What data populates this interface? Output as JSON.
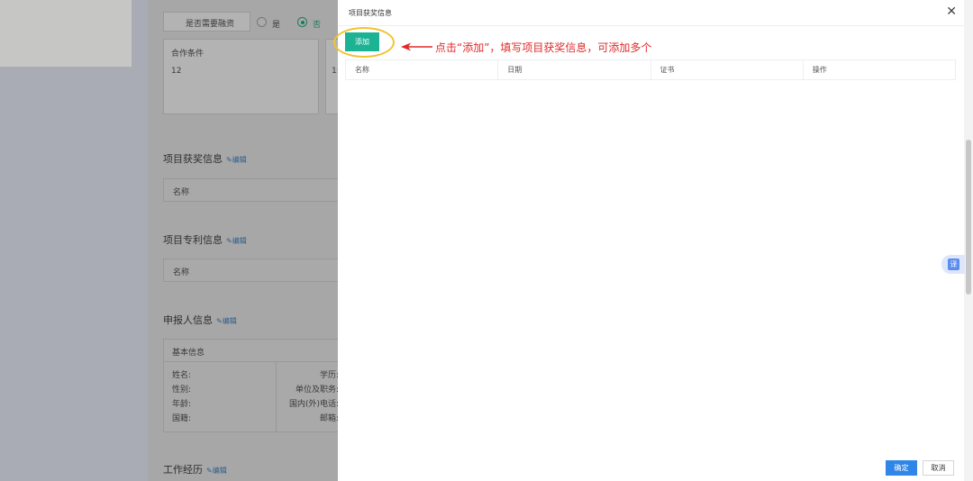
{
  "background": {
    "financing": {
      "label": "是否需要融资",
      "option_yes": "是",
      "option_no": "否",
      "selected": "否"
    },
    "cooperation": {
      "label": "合作条件",
      "value": "12",
      "value_clipped": "1:"
    },
    "awards_section": {
      "title": "项目获奖信息",
      "edit": "编辑",
      "col_name": "名称"
    },
    "patents_section": {
      "title": "项目专利信息",
      "edit": "编辑",
      "col_name": "名称"
    },
    "applicant_section": {
      "title": "申报人信息",
      "edit": "编辑",
      "basic_info": "基本信息",
      "fields_left": [
        "姓名:",
        "性别:",
        "年龄:",
        "国籍:"
      ],
      "fields_right": [
        "学历:",
        "单位及职务:",
        "国内(外)电话:",
        "邮箱:"
      ]
    },
    "work_section": {
      "title": "工作经历",
      "edit": "编辑"
    }
  },
  "modal": {
    "title": "项目获奖信息",
    "close_icon": "close-icon",
    "add_label": "添加",
    "annotation": "点击“添加”，填写项目获奖信息，可添加多个",
    "table_headers": [
      "名称",
      "日期",
      "证书",
      "操作"
    ],
    "translate_label": "译",
    "confirm_label": "确定",
    "cancel_label": "取消"
  },
  "colors": {
    "primary_green": "#1bb394",
    "primary_blue": "#2f86e8",
    "annotation_red": "#e02a2a",
    "highlight_yellow": "#f2c232"
  }
}
